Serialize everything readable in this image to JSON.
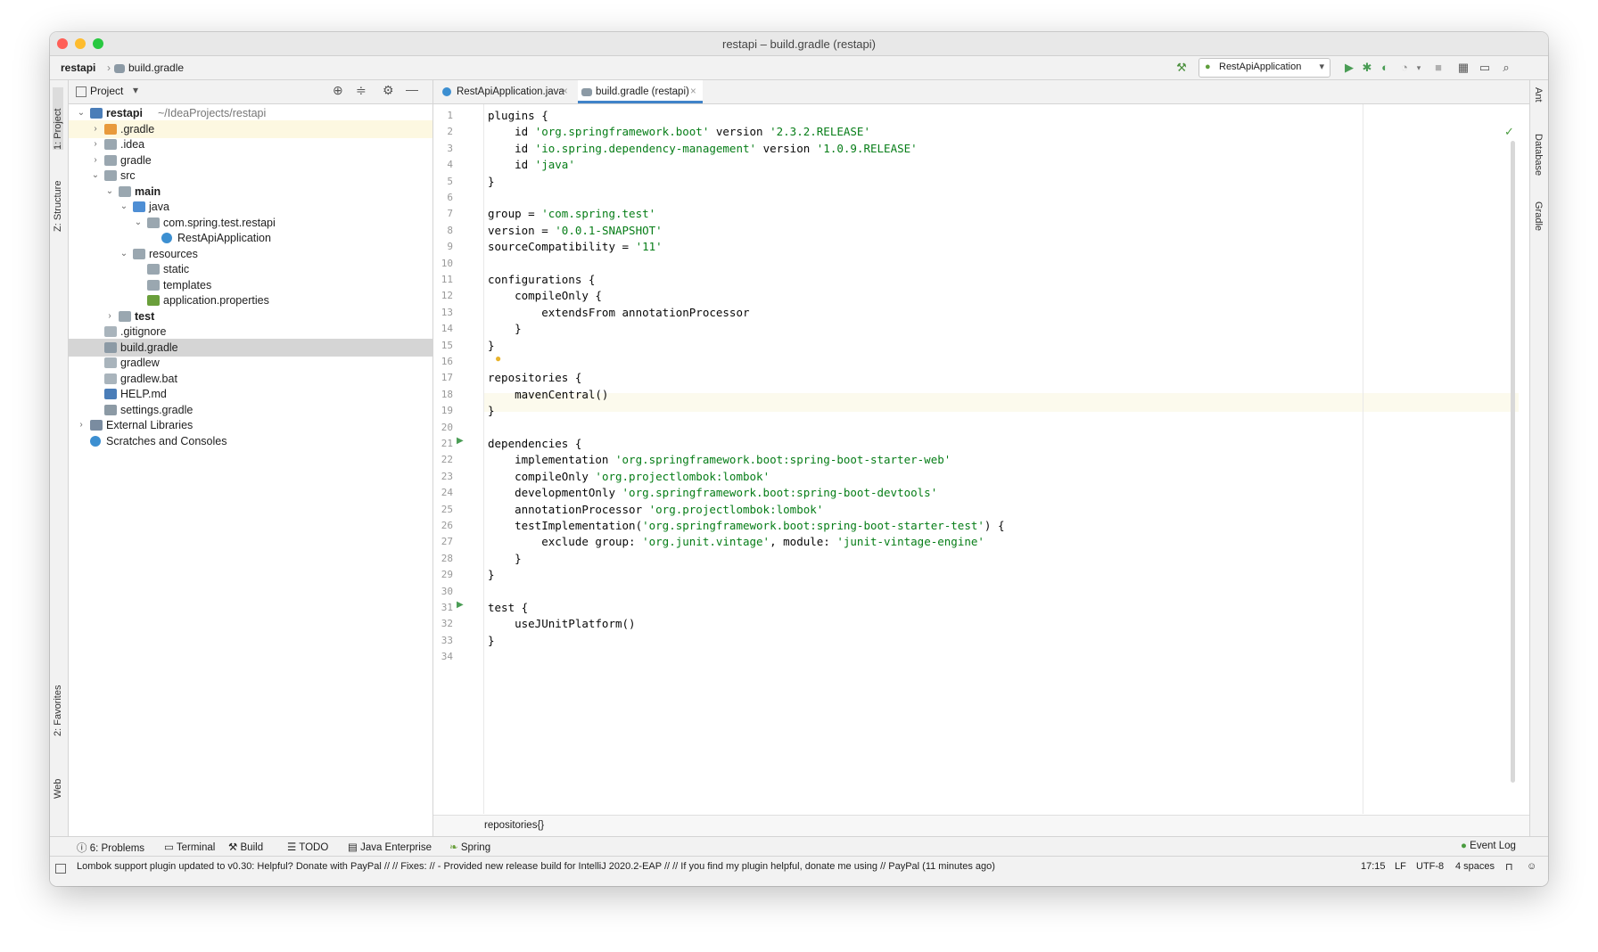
{
  "window": {
    "title": "restapi – build.gradle (restapi)"
  },
  "navbar": {
    "crumb_project": "restapi",
    "crumb_file": "build.gradle",
    "run_config": "RestApiApplication"
  },
  "left_strip": {
    "project": "1: Project",
    "structure": "Z: Structure",
    "favorites": "2: Favorites",
    "web": "Web"
  },
  "right_strip": {
    "ant": "Ant",
    "database": "Database",
    "gradle": "Gradle"
  },
  "project_panel": {
    "title": "Project",
    "tree": [
      {
        "label": "restapi",
        "extra": "~/IdeaProjects/restapi",
        "depth": 0,
        "arrow": "down",
        "icon": "module",
        "bold": true
      },
      {
        "label": ".gradle",
        "depth": 1,
        "arrow": "right",
        "icon": "folder-orange",
        "highlight": true
      },
      {
        "label": ".idea",
        "depth": 1,
        "arrow": "right",
        "icon": "folder"
      },
      {
        "label": "gradle",
        "depth": 1,
        "arrow": "right",
        "icon": "folder"
      },
      {
        "label": "src",
        "depth": 1,
        "arrow": "down",
        "icon": "folder"
      },
      {
        "label": "main",
        "depth": 2,
        "arrow": "down",
        "icon": "folder",
        "bold": true
      },
      {
        "label": "java",
        "depth": 3,
        "arrow": "down",
        "icon": "folder-blue"
      },
      {
        "label": "com.spring.test.restapi",
        "depth": 4,
        "arrow": "down",
        "icon": "package"
      },
      {
        "label": "RestApiApplication",
        "depth": 5,
        "arrow": "",
        "icon": "class"
      },
      {
        "label": "resources",
        "depth": 3,
        "arrow": "down",
        "icon": "folder"
      },
      {
        "label": "static",
        "depth": 4,
        "arrow": "",
        "icon": "folder"
      },
      {
        "label": "templates",
        "depth": 4,
        "arrow": "",
        "icon": "folder"
      },
      {
        "label": "application.properties",
        "depth": 4,
        "arrow": "",
        "icon": "props"
      },
      {
        "label": "test",
        "depth": 2,
        "arrow": "right",
        "icon": "folder",
        "bold": true
      },
      {
        "label": ".gitignore",
        "depth": 1,
        "arrow": "",
        "icon": "file"
      },
      {
        "label": "build.gradle",
        "depth": 1,
        "arrow": "",
        "icon": "gradle",
        "selected": true
      },
      {
        "label": "gradlew",
        "depth": 1,
        "arrow": "",
        "icon": "file"
      },
      {
        "label": "gradlew.bat",
        "depth": 1,
        "arrow": "",
        "icon": "file"
      },
      {
        "label": "HELP.md",
        "depth": 1,
        "arrow": "",
        "icon": "md"
      },
      {
        "label": "settings.gradle",
        "depth": 1,
        "arrow": "",
        "icon": "gradle"
      },
      {
        "label": "External Libraries",
        "depth": 0,
        "arrow": "right",
        "icon": "library"
      },
      {
        "label": "Scratches and Consoles",
        "depth": 0,
        "arrow": "",
        "icon": "scratch"
      }
    ]
  },
  "tabs": [
    {
      "label": "RestApiApplication.java",
      "active": false
    },
    {
      "label": "build.gradle (restapi)",
      "active": true
    }
  ],
  "code": [
    [
      [
        "plugins {",
        ""
      ]
    ],
    [
      [
        "    id ",
        ""
      ],
      [
        "'org.springframework.boot'",
        "str"
      ],
      [
        " version ",
        ""
      ],
      [
        "'2.3.2.RELEASE'",
        "str"
      ]
    ],
    [
      [
        "    id ",
        ""
      ],
      [
        "'io.spring.dependency-management'",
        "str"
      ],
      [
        " version ",
        ""
      ],
      [
        "'1.0.9.RELEASE'",
        "str"
      ]
    ],
    [
      [
        "    id ",
        ""
      ],
      [
        "'java'",
        "str"
      ]
    ],
    [
      [
        "}",
        ""
      ]
    ],
    [
      [
        "",
        ""
      ]
    ],
    [
      [
        "group = ",
        ""
      ],
      [
        "'com.spring.test'",
        "str"
      ]
    ],
    [
      [
        "version = ",
        ""
      ],
      [
        "'0.0.1-SNAPSHOT'",
        "str"
      ]
    ],
    [
      [
        "sourceCompatibility = ",
        ""
      ],
      [
        "'11'",
        "str"
      ]
    ],
    [
      [
        "",
        ""
      ]
    ],
    [
      [
        "configurations {",
        ""
      ]
    ],
    [
      [
        "    compileOnly {",
        ""
      ]
    ],
    [
      [
        "        extendsFrom annotationProcessor",
        ""
      ]
    ],
    [
      [
        "    }",
        ""
      ]
    ],
    [
      [
        "}",
        ""
      ]
    ],
    [
      [
        "",
        ""
      ]
    ],
    [
      [
        "repositories {",
        ""
      ]
    ],
    [
      [
        "    mavenCentral()",
        ""
      ]
    ],
    [
      [
        "}",
        ""
      ]
    ],
    [
      [
        "",
        ""
      ]
    ],
    [
      [
        "dependencies {",
        ""
      ]
    ],
    [
      [
        "    implementation ",
        ""
      ],
      [
        "'org.springframework.boot:spring-boot-starter-web'",
        "str"
      ]
    ],
    [
      [
        "    compileOnly ",
        ""
      ],
      [
        "'org.projectlombok:lombok'",
        "str"
      ]
    ],
    [
      [
        "    developmentOnly ",
        ""
      ],
      [
        "'org.springframework.boot:spring-boot-devtools'",
        "str"
      ]
    ],
    [
      [
        "    annotationProcessor ",
        ""
      ],
      [
        "'org.projectlombok:lombok'",
        "str"
      ]
    ],
    [
      [
        "    testImplementation(",
        ""
      ],
      [
        "'org.springframework.boot:spring-boot-starter-test'",
        "str"
      ],
      [
        ") {",
        ""
      ]
    ],
    [
      [
        "        exclude group: ",
        ""
      ],
      [
        "'org.junit.vintage'",
        "str"
      ],
      [
        ", module: ",
        ""
      ],
      [
        "'junit-vintage-engine'",
        "str"
      ]
    ],
    [
      [
        "    }",
        ""
      ]
    ],
    [
      [
        "}",
        ""
      ]
    ],
    [
      [
        "",
        ""
      ]
    ],
    [
      [
        "test {",
        ""
      ]
    ],
    [
      [
        "    useJUnitPlatform()",
        ""
      ]
    ],
    [
      [
        "}",
        ""
      ]
    ],
    [
      [
        "",
        ""
      ]
    ]
  ],
  "editor_breadcrumb": "repositories{}",
  "tool_windows": [
    {
      "label": "6: Problems",
      "icon": "problems-icon"
    },
    {
      "label": "Terminal",
      "icon": "terminal-icon"
    },
    {
      "label": "Build",
      "icon": "build-icon"
    },
    {
      "label": "TODO",
      "icon": "todo-icon"
    },
    {
      "label": "Java Enterprise",
      "icon": "java-enterprise-icon"
    },
    {
      "label": "Spring",
      "icon": "spring-icon"
    }
  ],
  "event_log": "Event Log",
  "status": {
    "message": "Lombok support plugin updated to v0.30: Helpful? Donate with PayPal // // Fixes: // - Provided new release build for IntelliJ 2020.2-EAP // // If you find my plugin helpful, donate me using // PayPal (11 minutes ago)",
    "position": "17:15",
    "line_sep": "LF",
    "encoding": "UTF-8",
    "indent": "4 spaces"
  }
}
